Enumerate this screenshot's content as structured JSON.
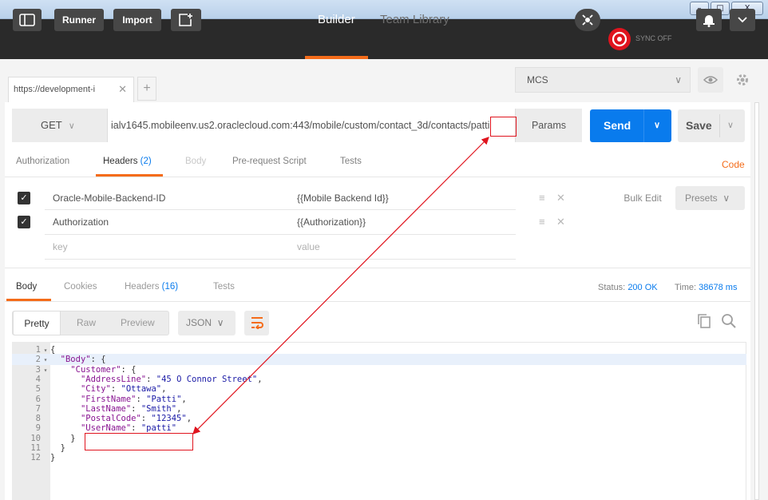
{
  "window": {
    "minimize": "–",
    "maximize": "□",
    "close": "X"
  },
  "header": {
    "runner": "Runner",
    "import": "Import",
    "tabs": {
      "builder": "Builder",
      "team_library": "Team Library"
    },
    "sync": "SYNC OFF"
  },
  "request_tab": {
    "title": "https://development-i",
    "close": "✕",
    "add": "+"
  },
  "environment": {
    "selected": "MCS"
  },
  "request": {
    "method": "GET",
    "url": "ialv1645.mobileenv.us2.oraclecloud.com:443/mobile/custom/contact_3d/contacts/patti",
    "params": "Params",
    "send": "Send",
    "save": "Save"
  },
  "request_tabs": {
    "authorization": "Authorization",
    "headers": "Headers",
    "headers_count": "(2)",
    "body": "Body",
    "pre_request": "Pre-request Script",
    "tests": "Tests",
    "code": "Code"
  },
  "headers_table": {
    "rows": [
      {
        "key": "Oracle-Mobile-Backend-ID",
        "value": "{{Mobile Backend Id}}"
      },
      {
        "key": "Authorization",
        "value": "{{Authorization}}"
      }
    ],
    "placeholder_key": "key",
    "placeholder_value": "value",
    "bulk_edit": "Bulk Edit",
    "presets": "Presets"
  },
  "response": {
    "tabs": {
      "body": "Body",
      "cookies": "Cookies",
      "headers": "Headers",
      "headers_count": "(16)",
      "tests": "Tests"
    },
    "status_label": "Status:",
    "status_value": "200 OK",
    "time_label": "Time:",
    "time_value": "38678 ms",
    "views": {
      "pretty": "Pretty",
      "raw": "Raw",
      "preview": "Preview"
    },
    "format": "JSON"
  },
  "code_lines": [
    {
      "n": "1",
      "fold": "▾",
      "text": "{"
    },
    {
      "n": "2",
      "fold": "▾",
      "text": "  \"Body\": {"
    },
    {
      "n": "3",
      "fold": "▾",
      "text": "    \"Customer\": {"
    },
    {
      "n": "4",
      "fold": "",
      "text": "      \"AddressLine\": \"45 O Connor Street\","
    },
    {
      "n": "5",
      "fold": "",
      "text": "      \"City\": \"Ottawa\","
    },
    {
      "n": "6",
      "fold": "",
      "text": "      \"FirstName\": \"Patti\","
    },
    {
      "n": "7",
      "fold": "",
      "text": "      \"LastName\": \"Smith\","
    },
    {
      "n": "8",
      "fold": "",
      "text": "      \"PostalCode\": \"12345\","
    },
    {
      "n": "9",
      "fold": "",
      "text": "      \"UserName\": \"patti\""
    },
    {
      "n": "10",
      "fold": "",
      "text": "    }"
    },
    {
      "n": "11",
      "fold": "",
      "text": "  }"
    },
    {
      "n": "12",
      "fold": "",
      "text": "}"
    }
  ],
  "colors": {
    "accent": "#f46c1a",
    "send_blue": "#097bed",
    "annotation_red": "#e0141e",
    "header_bg": "#2a2a2a"
  },
  "icons": [
    "sidebar-toggle-icon",
    "new-window-icon",
    "interceptor-icon",
    "sync-icon",
    "bell-icon",
    "chevron-down-icon",
    "eye-icon",
    "gear-icon",
    "checkbox-icon",
    "reorder-icon",
    "close-icon",
    "wrap-icon",
    "copy-icon",
    "search-icon"
  ]
}
